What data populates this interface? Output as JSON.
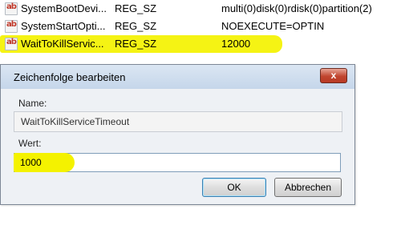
{
  "registry": {
    "rows": [
      {
        "icon": "ab",
        "name": "SystemBootDevi...",
        "type": "REG_SZ",
        "data": "multi(0)disk(0)rdisk(0)partition(2)"
      },
      {
        "icon": "ab",
        "name": "SystemStartOpti...",
        "type": "REG_SZ",
        "data": "NOEXECUTE=OPTIN"
      },
      {
        "icon": "ab",
        "name": "WaitToKillServic...",
        "type": "REG_SZ",
        "data": "12000"
      }
    ],
    "highlight_color": "#f4f200"
  },
  "dialog": {
    "title": "Zeichenfolge bearbeiten",
    "close_label": "x",
    "name_label": "Name:",
    "name_value": "WaitToKillServiceTimeout",
    "value_label": "Wert:",
    "value_value": "1000",
    "ok_label": "OK",
    "cancel_label": "Abbrechen"
  }
}
